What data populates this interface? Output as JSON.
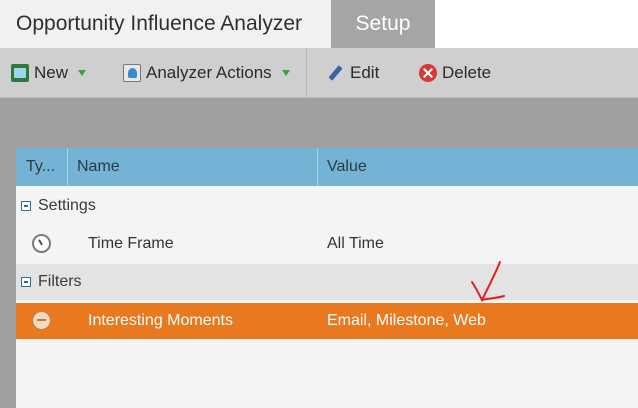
{
  "tabs": {
    "main": "Opportunity Influence Analyzer",
    "setup": "Setup"
  },
  "toolbar": {
    "new_label": "New",
    "analyzer_actions_label": "Analyzer Actions",
    "edit_label": "Edit",
    "delete_label": "Delete",
    "icons": [
      "new-icon",
      "analyzer-icon",
      "pencil-icon",
      "delete-icon"
    ]
  },
  "grid": {
    "columns": [
      "Ty...",
      "Name",
      "Value"
    ],
    "groups": [
      {
        "label": "Settings",
        "rows": [
          {
            "icon": "clock-icon",
            "name": "Time Frame",
            "value": "All Time"
          }
        ]
      },
      {
        "label": "Filters",
        "rows": [
          {
            "icon": "chat-icon",
            "name": "Interesting Moments",
            "value": "Email, Milestone, Web",
            "selected": true
          }
        ]
      }
    ]
  },
  "colors": {
    "header": "#74b3d3",
    "selected_row": "#e9791e",
    "toolbar": "#cfcfcf",
    "annotation": "#e0201a"
  }
}
